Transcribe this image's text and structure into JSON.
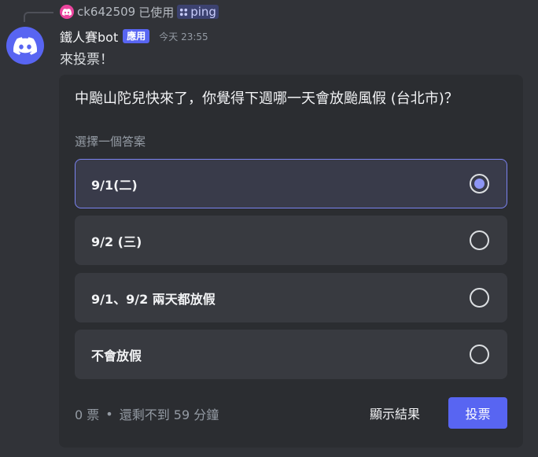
{
  "reply": {
    "user": "ck642509",
    "used_text": "已使用",
    "command": "ping"
  },
  "message": {
    "author": "鐵人賽bot",
    "app_tag": "應用",
    "timestamp": "今天 23:55",
    "text": "來投票！"
  },
  "poll": {
    "question": "中颱山陀兒快來了，你覺得下週哪一天會放颱風假 (台北市)？",
    "hint": "選擇一個答案",
    "options": [
      {
        "label": "9/1(二)",
        "selected": true
      },
      {
        "label": "9/2 (三)",
        "selected": false
      },
      {
        "label": "9/1、9/2 兩天都放假",
        "selected": false
      },
      {
        "label": "不會放假",
        "selected": false
      }
    ],
    "votes": "0 票",
    "separator": "•",
    "time_left": "還剩不到 59 分鐘",
    "show_results_label": "顯示結果",
    "vote_label": "投票"
  },
  "colors": {
    "accent": "#5865f2",
    "background": "#313338",
    "poll_background": "#2b2d31"
  }
}
